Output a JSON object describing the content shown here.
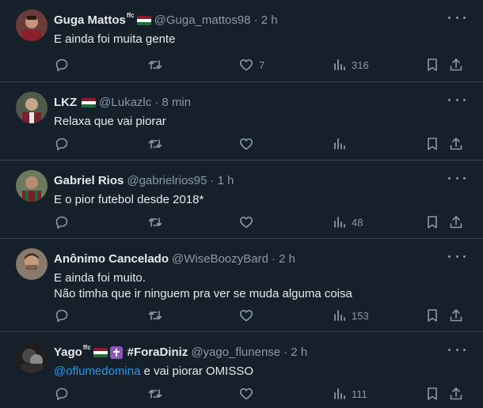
{
  "icon_color": "#8b98a5",
  "mention_color": "#1d9bf0",
  "tweets": [
    {
      "name": "Guga Mattos",
      "sup": "ffc",
      "handle": "@Guga_mattos98",
      "time": "· 2 h",
      "lines": [
        "E ainda foi muita gente"
      ],
      "likes": "7",
      "views": "316"
    },
    {
      "name": "LKZ",
      "sup": "",
      "handle": "@Lukazlc",
      "time": "· 8 min",
      "lines": [
        "Relaxa que vai piorar"
      ],
      "likes": "",
      "views": ""
    },
    {
      "name": "Gabriel Rios",
      "sup": "",
      "handle": "@gabrielrios95",
      "time": "· 1 h",
      "lines": [
        "E o pior futebol desde 2018*"
      ],
      "likes": "",
      "views": "48"
    },
    {
      "name": "Anônimo Cancelado",
      "sup": "",
      "handle": "@WiseBoozyBard",
      "time": "· 2 h",
      "lines": [
        "E ainda foi muito.",
        "Não timha que ir ninguem pra ver se muda alguma coisa"
      ],
      "likes": "",
      "views": "153"
    },
    {
      "name": "Yago",
      "sup": "ffc",
      "tag": "#ForaDiniz",
      "handle": "@yago_flunense",
      "time": "· 2 h",
      "mention": "@oflumedomina",
      "reply_text": " e vai piorar OMISSO",
      "likes": "",
      "views": "111"
    }
  ]
}
